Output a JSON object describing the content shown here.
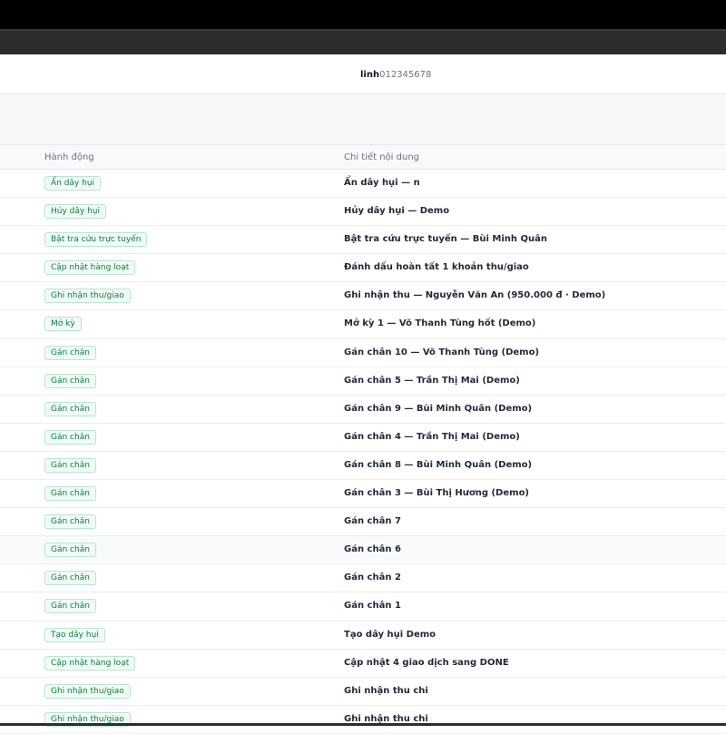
{
  "user": {
    "name": "linh",
    "phone": "012345678"
  },
  "table": {
    "headers": {
      "action": "Hành động",
      "detail": "Chi tiết nội dung"
    },
    "rows": [
      {
        "action": "Ẩn dây hụi",
        "detail": "Ẩn dây hụi — n"
      },
      {
        "action": "Hủy dây hụi",
        "detail": "Hủy dây hụi — Demo"
      },
      {
        "action": "Bật tra cứu trực tuyến",
        "detail": "Bật tra cứu trực tuyến — Bùi Minh Quân"
      },
      {
        "action": "Cập nhật hàng loạt",
        "detail": "Đánh dấu hoàn tất 1 khoản thu/giao"
      },
      {
        "action": "Ghi nhận thu/giao",
        "detail": "Ghi nhận thu — Nguyễn Văn An (950.000 đ · Demo)"
      },
      {
        "action": "Mở kỳ",
        "detail": "Mở kỳ 1 — Võ Thanh Tùng hốt (Demo)"
      },
      {
        "action": "Gán chân",
        "detail": "Gán chân 10 — Võ Thanh Tùng (Demo)"
      },
      {
        "action": "Gán chân",
        "detail": "Gán chân 5 — Trần Thị Mai (Demo)"
      },
      {
        "action": "Gán chân",
        "detail": "Gán chân 9 — Bùi Minh Quân (Demo)"
      },
      {
        "action": "Gán chân",
        "detail": "Gán chân 4 — Trần Thị Mai (Demo)"
      },
      {
        "action": "Gán chân",
        "detail": "Gán chân 8 — Bùi Minh Quân (Demo)"
      },
      {
        "action": "Gán chân",
        "detail": "Gán chân 3 — Bùi Thị Hương (Demo)"
      },
      {
        "action": "Gán chân",
        "detail": "Gán chân 7"
      },
      {
        "action": "Gán chân",
        "detail": "Gán chân 6"
      },
      {
        "action": "Gán chân",
        "detail": "Gán chân 2"
      },
      {
        "action": "Gán chân",
        "detail": "Gán chân 1"
      },
      {
        "action": "Tạo dây hụi",
        "detail": "Tạo dây hụi Demo"
      },
      {
        "action": "Cập nhật hàng loạt",
        "detail": "Cập nhật 4 giao dịch sang DONE"
      },
      {
        "action": "Ghi nhận thu/giao",
        "detail": "Ghi nhận thu chi"
      },
      {
        "action": "Ghi nhận thu/giao",
        "detail": "Ghi nhận thu chi"
      }
    ]
  },
  "colors": {
    "badge_text": "#0f7a4a",
    "badge_bg": "#f1fbf5",
    "badge_border": "#b9e6cc"
  }
}
